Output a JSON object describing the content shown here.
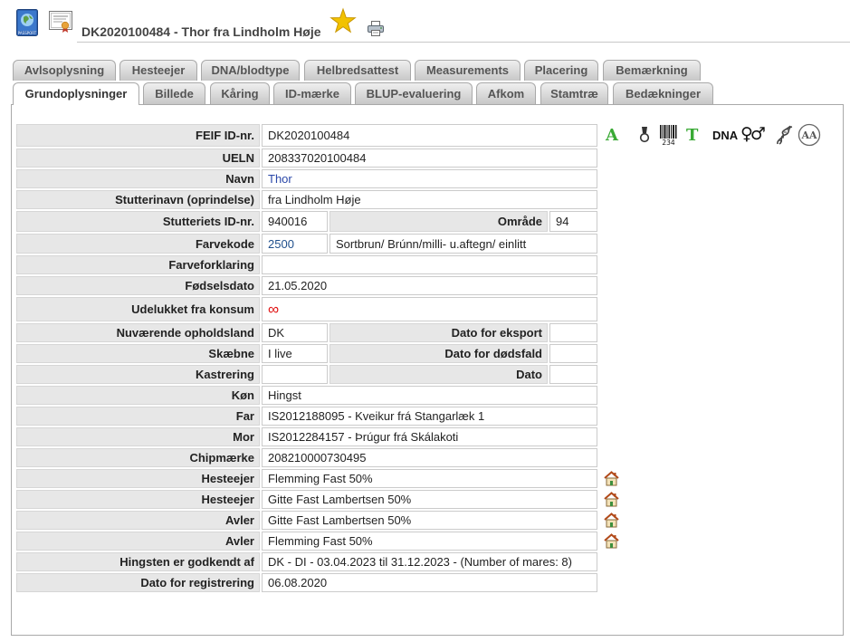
{
  "header": {
    "title": "DK2020100484 - Thor fra Lindholm Høje",
    "passport_label": "PASSPORT"
  },
  "icons": {
    "passport": "passport-icon",
    "certificate": "certificate-icon",
    "favorite": "star-icon",
    "print": "printer-icon",
    "owner_home": "house-icon"
  },
  "tabs": {
    "row1": [
      {
        "label": "Avlsoplysning"
      },
      {
        "label": "Hesteejer"
      },
      {
        "label": "DNA/blodtype"
      },
      {
        "label": "Helbredsattest"
      },
      {
        "label": "Measurements"
      },
      {
        "label": "Placering"
      },
      {
        "label": "Bemærkning"
      }
    ],
    "row2": [
      {
        "label": "Grundoplysninger",
        "active": true
      },
      {
        "label": "Billede"
      },
      {
        "label": "Kåring"
      },
      {
        "label": "ID-mærke"
      },
      {
        "label": "BLUP-evaluering"
      },
      {
        "label": "Afkom"
      },
      {
        "label": "Stamtræ"
      },
      {
        "label": "Bedækninger"
      }
    ]
  },
  "badges": {
    "assessment": {
      "text": "A",
      "icon": "assessment-icon"
    },
    "medal": {
      "icon": "medal-icon"
    },
    "barcode": {
      "text": "234",
      "icon": "barcode-icon"
    },
    "test": {
      "text": "T",
      "icon": "test-icon"
    },
    "dna": {
      "text": "DNA"
    },
    "sex": {
      "text": "♀♂",
      "icon": "sex-symbol-icon"
    },
    "helix": {
      "icon": "dna-helix-icon"
    },
    "aa": {
      "text": "AA",
      "icon": "aa-circle-icon"
    }
  },
  "colors": {
    "badge_green": "#3aaa35",
    "link_blue": "#2a47a8",
    "infinity_red": "#e01010",
    "star_gold": "#f2c200",
    "label_bg": "#e7e7e7"
  },
  "fields": {
    "feif_id": {
      "label": "FEIF ID-nr.",
      "value": "DK2020100484"
    },
    "ueln": {
      "label": "UELN",
      "value": "208337020100484"
    },
    "name": {
      "label": "Navn",
      "value": "Thor"
    },
    "stud_name": {
      "label": "Stutterinavn (oprindelse)",
      "value": "fra Lindholm Høje"
    },
    "stud_id": {
      "label": "Stutteriets ID-nr.",
      "value": "940016"
    },
    "area": {
      "label": "Område",
      "value": "94"
    },
    "color_code": {
      "label": "Farvekode",
      "value": "2500",
      "description": "Sortbrun/ Brúnn/milli- u.aftegn/ einlitt"
    },
    "color_explanation": {
      "label": "Farveforklaring",
      "value": ""
    },
    "birth_date": {
      "label": "Fødselsdato",
      "value": "21.05.2020"
    },
    "excluded_consumption": {
      "label": "Udelukket fra konsum",
      "value": "∞"
    },
    "country": {
      "label": "Nuværende opholdsland",
      "value": "DK"
    },
    "export_date": {
      "label": "Dato for eksport",
      "value": ""
    },
    "fate": {
      "label": "Skæbne",
      "value": "I live"
    },
    "death_date": {
      "label": "Dato for dødsfald",
      "value": ""
    },
    "castration": {
      "label": "Kastrering",
      "value": ""
    },
    "castration_date": {
      "label": "Dato",
      "value": ""
    },
    "sex": {
      "label": "Køn",
      "value": "Hingst"
    },
    "sire": {
      "label": "Far",
      "value": "IS2012188095 - Kveikur frá Stangarlæk 1"
    },
    "dam": {
      "label": "Mor",
      "value": "IS2012284157 - Þrúgur frá Skálakoti"
    },
    "chip": {
      "label": "Chipmærke",
      "value": "208210000730495"
    },
    "owners": [
      {
        "label": "Hesteejer",
        "value": "Flemming Fast 50%"
      },
      {
        "label": "Hesteejer",
        "value": "Gitte Fast Lambertsen 50%"
      }
    ],
    "breeders": [
      {
        "label": "Avler",
        "value": "Gitte Fast Lambertsen 50%"
      },
      {
        "label": "Avler",
        "value": "Flemming Fast 50%"
      }
    ],
    "approved_by": {
      "label": "Hingsten er godkendt af",
      "value": "DK - DI - 03.04.2023 til 31.12.2023 - (Number of mares: 8)"
    },
    "registration_date": {
      "label": "Dato for registrering",
      "value": "06.08.2020"
    }
  }
}
